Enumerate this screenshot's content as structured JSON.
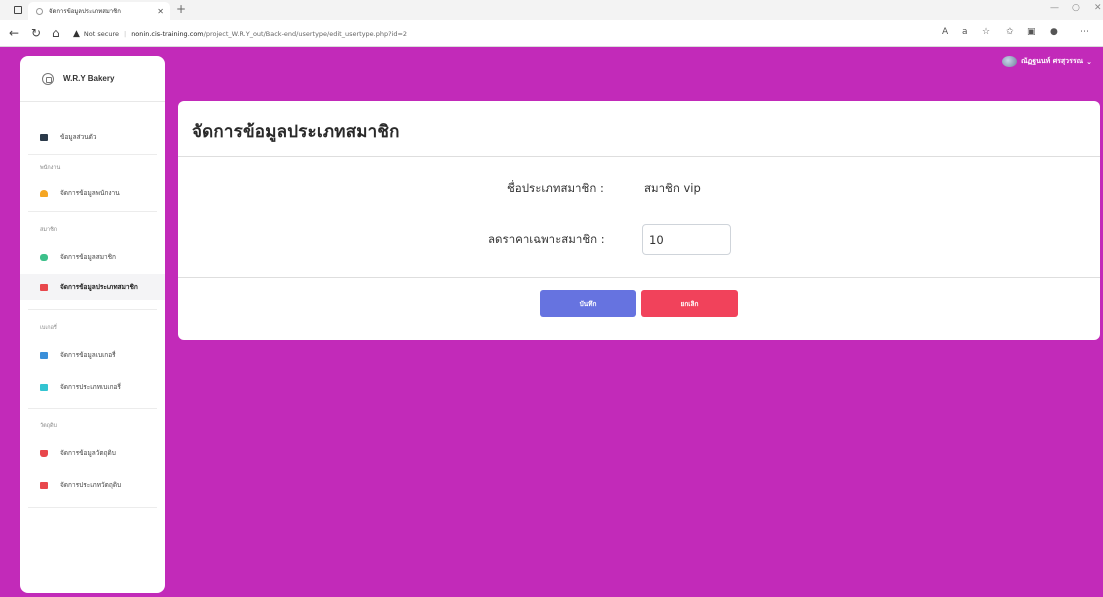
{
  "browser": {
    "tab_title": "จัดการข้อมูลประเภทสมาชิก",
    "not_secure": "Not secure",
    "url_host": "nonin.cis-training.com",
    "url_path": "/project_W.R.Y_out/Back-end/usertype/edit_usertype.php?id=2"
  },
  "sidebar": {
    "brand": "W.R.Y Bakery",
    "profile_item": "ข้อมูลส่วนตัว",
    "sections": [
      {
        "heading": "พนักงาน",
        "items": [
          "จัดการข้อมูลพนักงาน"
        ]
      },
      {
        "heading": "สมาชิก",
        "items": [
          "จัดการข้อมูลสมาชิก",
          "จัดการข้อมูลประเภทสมาชิก"
        ]
      },
      {
        "heading": "เบเกอรี่",
        "items": [
          "จัดการข้อมูลเบเกอรี่",
          "จัดการประเภทเบเกอรี่"
        ]
      },
      {
        "heading": "วัตถุดิบ",
        "items": [
          "จัดการข้อมูลวัตถุดิบ",
          "จัดการประเภทวัตถุดิบ"
        ]
      }
    ],
    "active_item": "จัดการข้อมูลประเภทสมาชิก"
  },
  "user": {
    "name": "ณัฏฐนนท์ ศรสุวรรณ"
  },
  "main": {
    "title": "จัดการข้อมูลประเภทสมาชิก",
    "type_name_label": "ชื่อประเภทสมาชิก :",
    "type_name_value": "สมาชิก vip",
    "discount_label": "ลดราคาเฉพาะสมาชิก :",
    "discount_value": "10",
    "save_label": "บันทึก",
    "cancel_label": "ยกเลิก"
  },
  "colors": {
    "page_bg": "#c22ab9",
    "save_button": "#6673e0",
    "cancel_button": "#f1425b"
  }
}
